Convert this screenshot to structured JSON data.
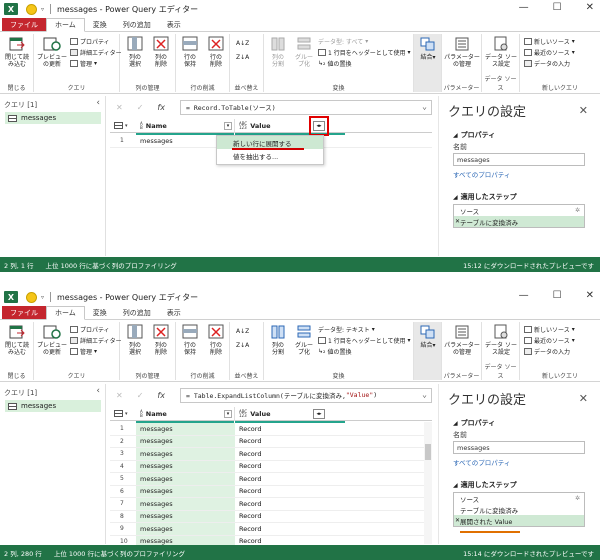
{
  "window_title": "messages - Power Query エディター",
  "tabs": [
    "ファイル",
    "ホーム",
    "変換",
    "列の追加",
    "表示"
  ],
  "ribbon": {
    "close_load": "閉じて読\nみ込む",
    "close_grp": "閉じる",
    "preview_refresh": "プレビュー\nの更新",
    "properties": "プロパティ",
    "advanced_editor": "詳細エディター",
    "manage": "管理",
    "query_grp": "クエリ",
    "select_cols": "列の\n選択",
    "remove_cols": "列の\n削除",
    "col_mgmt_grp": "列の管理",
    "keep_rows": "行の\n保持",
    "remove_rows": "行の\n削除",
    "row_reduce_grp": "行の削減",
    "sort_grp": "並べ替え",
    "split_col": "列の\n分割",
    "group_by": "グルー\nプ化",
    "use_first_row": "1 行目をヘッダーとして使用",
    "replace_values": "値の置換",
    "transform_grp": "変換",
    "combine": "結合",
    "params_manage": "パラメーター\nの管理",
    "params_grp": "パラメーター",
    "ds_settings": "データ ソー\nス設定",
    "ds_grp": "データ ソース",
    "new_source": "新しいソース",
    "recent_source": "最近のソース",
    "enter_data": "データの入力",
    "new_query_grp": "新しいクエリ"
  },
  "top": {
    "datatype": "データ型: すべて",
    "formula_prefix": "= Record.ToTable(ソース)",
    "col1": "Name",
    "col2": "Value",
    "rows": [
      {
        "n": "1",
        "name": "messages",
        "value": ""
      }
    ],
    "menu": [
      "新しい行に展開する",
      "値を抽出する..."
    ],
    "steps": [
      "ソース",
      "テーブルに変換済み"
    ],
    "status_left": "2 列, 1 行",
    "status_profile": "上位 1000 行に基づく列のプロファイリング",
    "status_right": "15:12 にダウンロードされたプレビューです"
  },
  "bottom": {
    "datatype": "データ型: テキスト",
    "formula_a": "= Table.ExpandListColumn(テーブルに変換済み, ",
    "formula_b": "\"Value\"",
    "formula_c": ")",
    "col1": "Name",
    "col2": "Value",
    "rows": [
      {
        "n": "1",
        "name": "messages",
        "value": "Record"
      },
      {
        "n": "2",
        "name": "messages",
        "value": "Record"
      },
      {
        "n": "3",
        "name": "messages",
        "value": "Record"
      },
      {
        "n": "4",
        "name": "messages",
        "value": "Record"
      },
      {
        "n": "5",
        "name": "messages",
        "value": "Record"
      },
      {
        "n": "6",
        "name": "messages",
        "value": "Record"
      },
      {
        "n": "7",
        "name": "messages",
        "value": "Record"
      },
      {
        "n": "8",
        "name": "messages",
        "value": "Record"
      },
      {
        "n": "9",
        "name": "messages",
        "value": "Record"
      },
      {
        "n": "10",
        "name": "messages",
        "value": "Record"
      }
    ],
    "steps": [
      "ソース",
      "テーブルに変換済み",
      "展開された Value"
    ],
    "status_left": "2 列, 280 行",
    "status_profile": "上位 1000 行に基づく列のプロファイリング",
    "status_right": "15:14 にダウンロードされたプレビューです"
  },
  "queries_label": "クエリ [1]",
  "query_item": "messages",
  "settings": {
    "title": "クエリの設定",
    "properties": "プロパティ",
    "name_label": "名前",
    "name_value": "messages",
    "all_props": "すべてのプロパティ",
    "applied_steps": "適用したステップ"
  },
  "colors": {
    "excel_green": "#217346",
    "accent_teal": "#24a48c",
    "highlight": "#e00000",
    "underline_orange": "#e07000"
  }
}
